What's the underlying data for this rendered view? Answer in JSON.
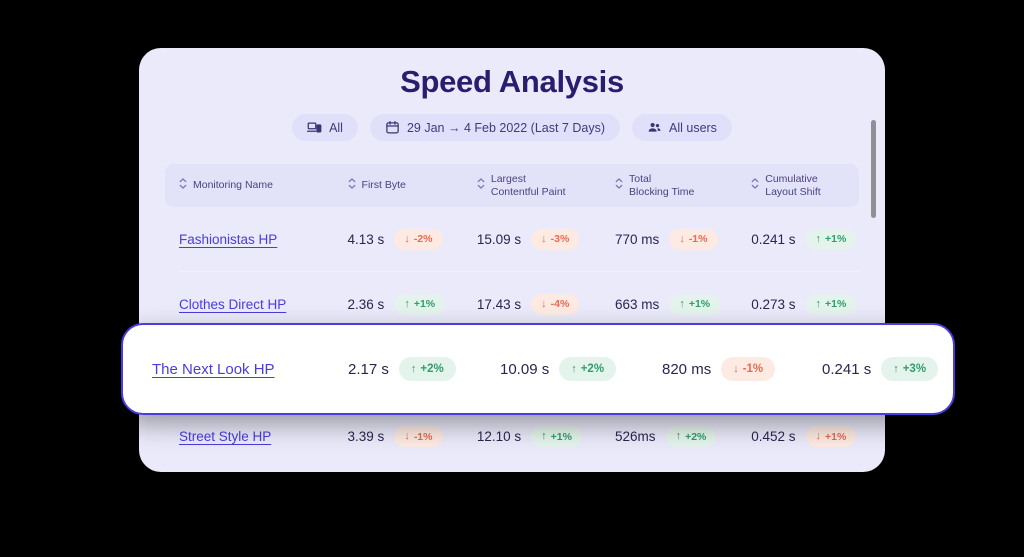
{
  "header": {
    "title": "Speed Analysis"
  },
  "filters": [
    {
      "icon": "devices-icon",
      "label": "All"
    },
    {
      "icon": "calendar-icon",
      "label": "29 Jan → 4 Feb 2022 (Last 7 Days)"
    },
    {
      "icon": "users-icon",
      "label": "All users"
    }
  ],
  "table": {
    "columns": [
      {
        "label": "Monitoring Name",
        "sort_icon": "sort-icon"
      },
      {
        "label": "First Byte",
        "sort_icon": "sort-icon"
      },
      {
        "label": "Largest\nContentful Paint",
        "sort_icon": "sort-icon"
      },
      {
        "label": "Total\nBlocking Time",
        "sort_icon": "sort-icon"
      },
      {
        "label": "Cumulative\nLayout Shift",
        "sort_icon": "sort-icon"
      }
    ],
    "rows": [
      {
        "name": "Fashionistas HP",
        "highlighted": false,
        "metrics": [
          {
            "value": "4.13 s",
            "delta": "-2%",
            "direction": "down",
            "trend": "negative"
          },
          {
            "value": "15.09 s",
            "delta": "-3%",
            "direction": "down",
            "trend": "negative"
          },
          {
            "value": "770 ms",
            "delta": "-1%",
            "direction": "down",
            "trend": "negative"
          },
          {
            "value": "0.241 s",
            "delta": "+1%",
            "direction": "up",
            "trend": "positive"
          }
        ]
      },
      {
        "name": "Clothes Direct HP",
        "highlighted": false,
        "metrics": [
          {
            "value": "2.36 s",
            "delta": "+1%",
            "direction": "up",
            "trend": "positive"
          },
          {
            "value": "17.43 s",
            "delta": "-4%",
            "direction": "down",
            "trend": "negative"
          },
          {
            "value": "663 ms",
            "delta": "+1%",
            "direction": "up",
            "trend": "positive"
          },
          {
            "value": "0.273 s",
            "delta": "+1%",
            "direction": "up",
            "trend": "positive"
          }
        ]
      },
      {
        "name": "The Next Look HP",
        "highlighted": true,
        "metrics": [
          {
            "value": "2.17 s",
            "delta": "+2%",
            "direction": "up",
            "trend": "positive"
          },
          {
            "value": "10.09 s",
            "delta": "+2%",
            "direction": "up",
            "trend": "positive"
          },
          {
            "value": "820 ms",
            "delta": "-1%",
            "direction": "down",
            "trend": "negative"
          },
          {
            "value": "0.241 s",
            "delta": "+3%",
            "direction": "up",
            "trend": "positive"
          }
        ]
      },
      {
        "name": "Street Style HP",
        "highlighted": false,
        "metrics": [
          {
            "value": "3.39 s",
            "delta": "-1%",
            "direction": "down",
            "trend": "negative"
          },
          {
            "value": "12.10 s",
            "delta": "+1%",
            "direction": "up",
            "trend": "positive"
          },
          {
            "value": "526ms",
            "delta": "+2%",
            "direction": "up",
            "trend": "positive"
          },
          {
            "value": "0.452 s",
            "delta": "+1%",
            "direction": "down",
            "trend": "negative"
          }
        ]
      }
    ]
  },
  "colors": {
    "panel_bg": "#eaeafa",
    "title": "#2b1d6e",
    "link": "#4a3ce0",
    "accent_border": "#4a3ce0",
    "positive": "#2f9e6b",
    "negative": "#ec6a52",
    "positive_bg": "#e4f4ec",
    "negative_bg": "#fdeae2",
    "pill_bg": "#e0e0fa",
    "header_bg": "#e2e2f8"
  },
  "scrollbar": {
    "name": "vertical-scrollbar"
  }
}
